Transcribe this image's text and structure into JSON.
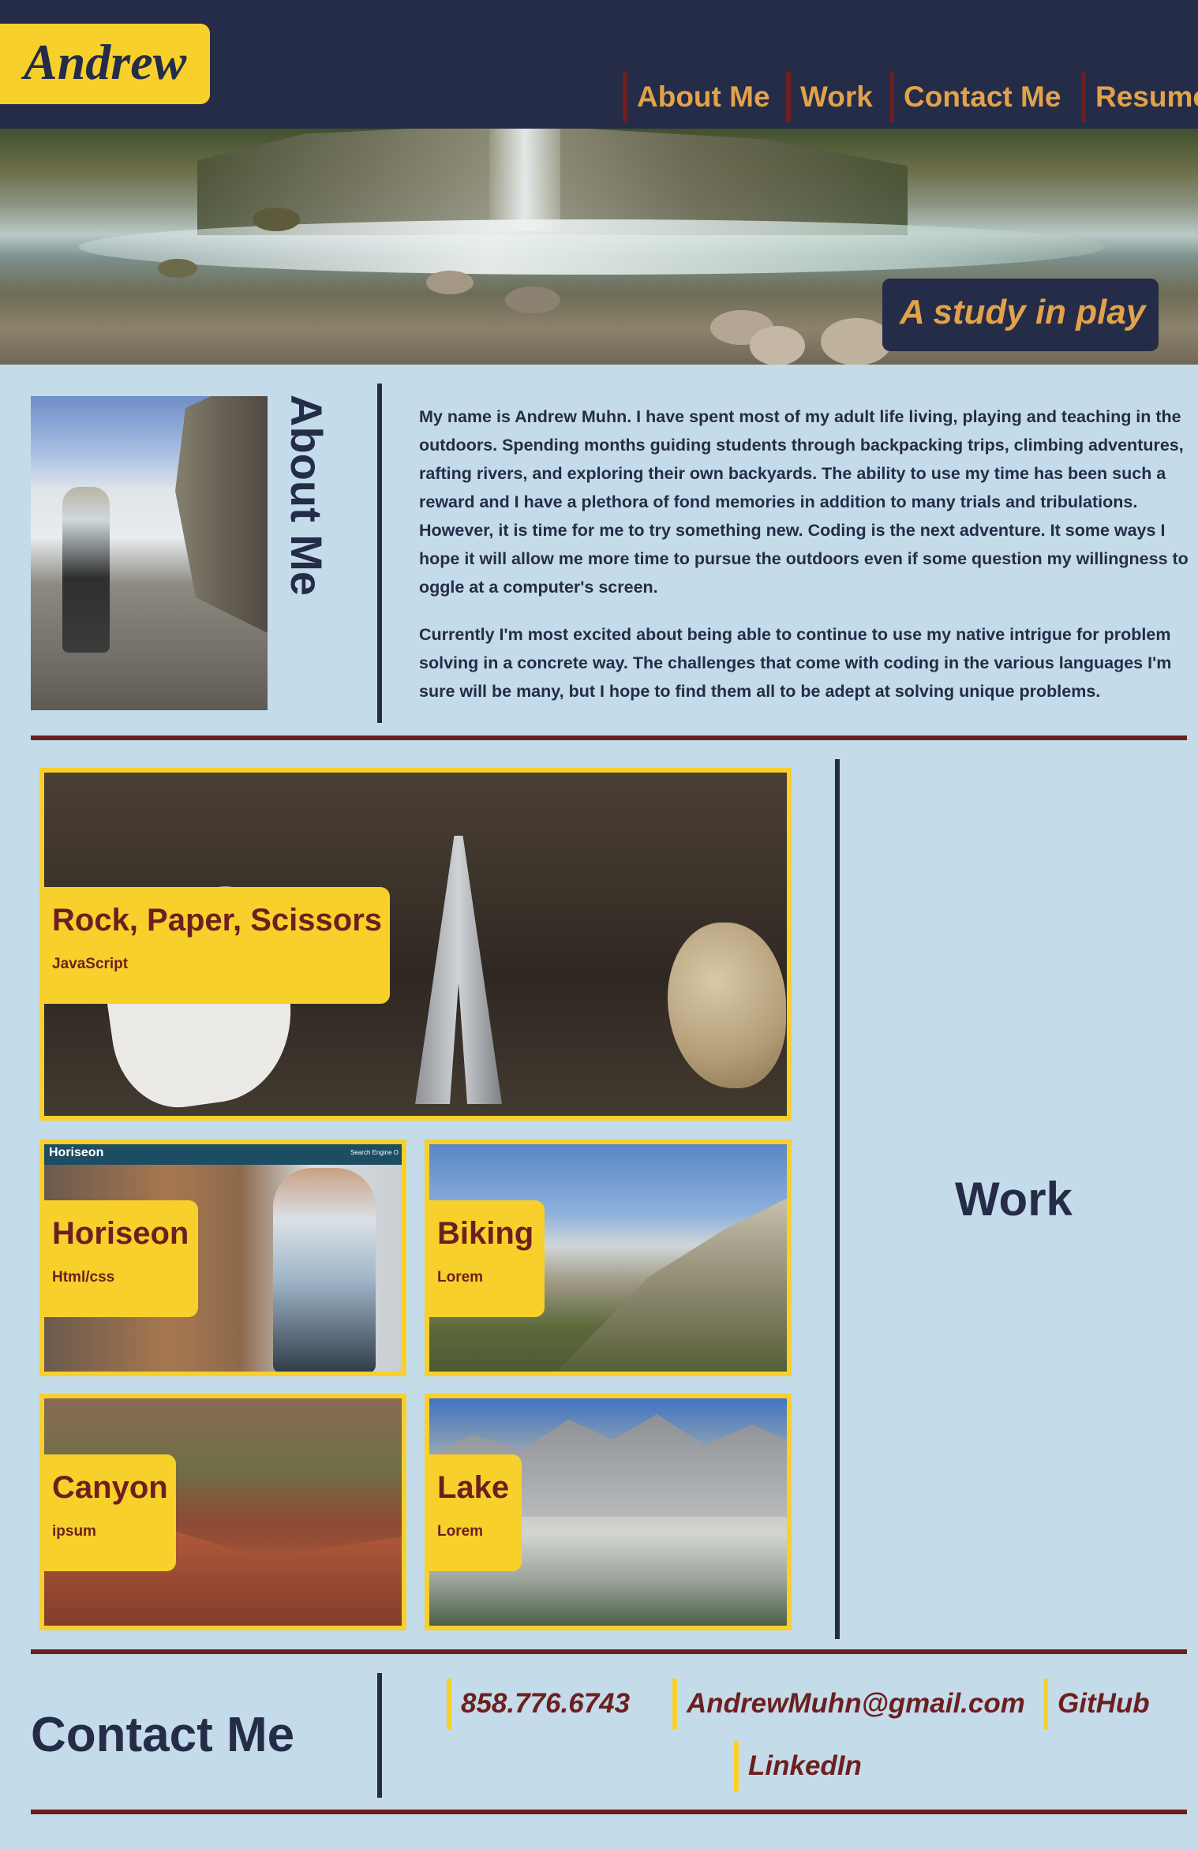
{
  "header": {
    "logo": "Andrew",
    "nav": [
      "About Me",
      "Work",
      "Contact Me",
      "Resume"
    ]
  },
  "hero": {
    "tagline": "A study in play"
  },
  "about": {
    "title": "About Me",
    "paragraphs": [
      "My name is Andrew Muhn. I have spent most of my adult life living, playing and teaching in the outdoors. Spending months guiding students through backpacking trips, climbing adventures, rafting rivers, and exploring their own backyards. The ability to use my time has been such a reward and I have a plethora of fond memories in addition to many trials and tribulations. However, it is time for me to try something new. Coding is the next adventure. It some ways I hope it will allow me more time to pursue the outdoors even if some question my willingness to oggle at a computer's screen.",
      "Currently I'm most excited about being able to continue to use my native intrigue for problem solving in a concrete way. The challenges that come with coding in the various languages I'm sure will be many, but I hope to find them all to be adept at solving unique problems."
    ]
  },
  "work": {
    "title": "Work",
    "projects": [
      {
        "title": "Rock, Paper, Scissors",
        "subtitle": "JavaScript"
      },
      {
        "title": "Horiseon",
        "subtitle": "Html/css",
        "screenshot_brand": "Horiseon",
        "screenshot_nav": "Search Engine O"
      },
      {
        "title": "Biking",
        "subtitle": "Lorem"
      },
      {
        "title": "Canyon",
        "subtitle": "ipsum"
      },
      {
        "title": "Lake",
        "subtitle": "Lorem"
      }
    ]
  },
  "contact": {
    "title": "Contact Me",
    "links": [
      "858.776.6743",
      "AndrewMuhn@gmail.com",
      "GitHub",
      "LinkedIn"
    ]
  },
  "colors": {
    "navy": "#242c48",
    "yellow": "#f7d02b",
    "maroon": "#6d1f1f",
    "orange": "#e2a24a",
    "background": "#c4dbea"
  }
}
